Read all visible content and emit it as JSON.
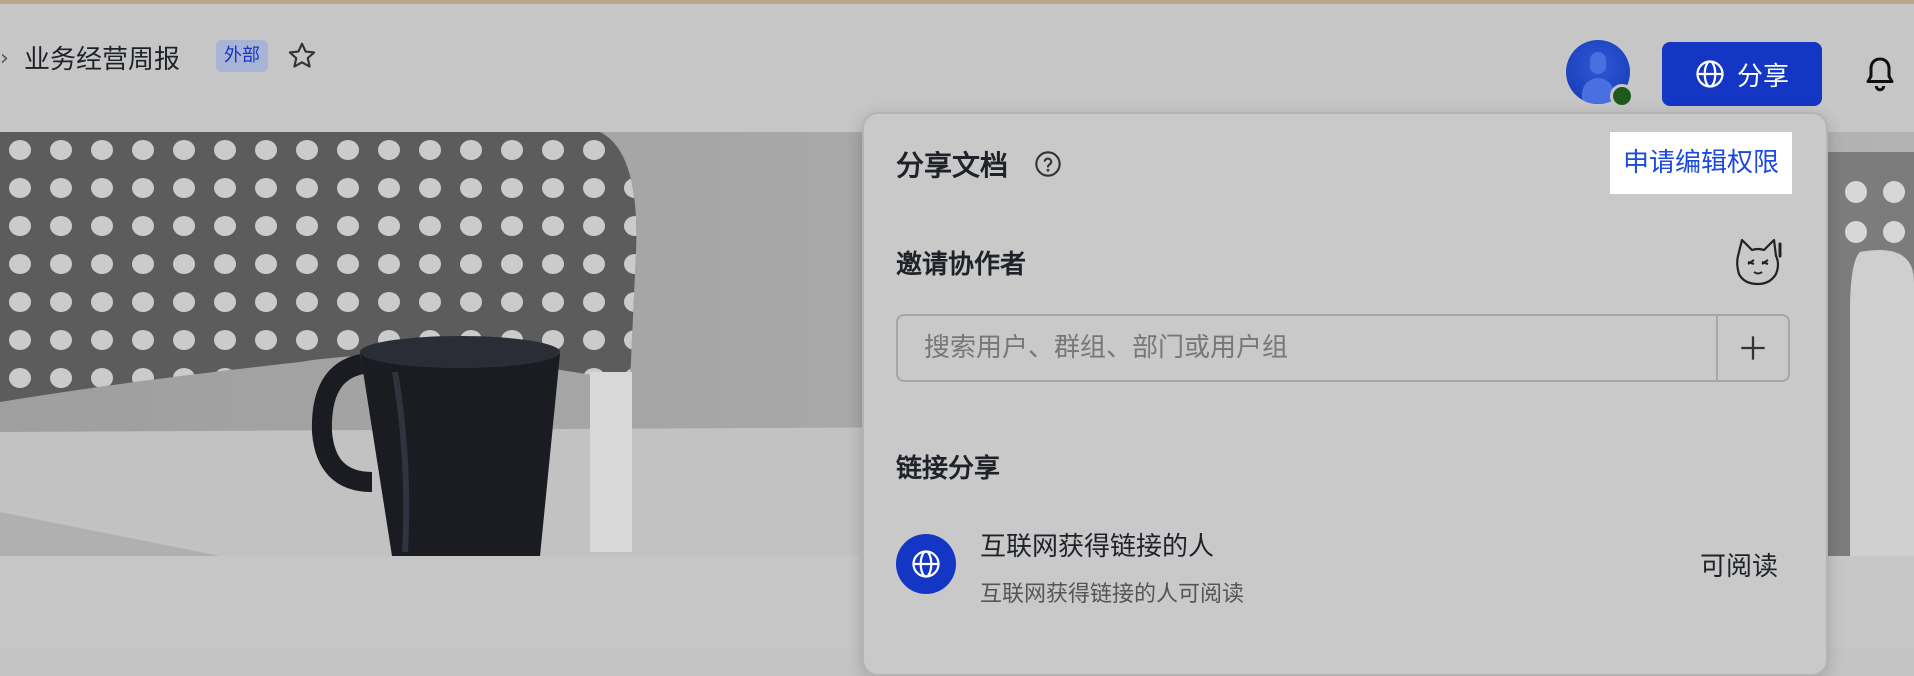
{
  "header": {
    "breadcrumb_chevron": "›",
    "title": "业务经营周报",
    "tag": "外部",
    "share_label": "分享",
    "presence_color": "#1e5a1e"
  },
  "icons": {
    "star": "star-icon",
    "avatar": "user-avatar",
    "globe": "globe-icon",
    "bell": "bell-icon",
    "help": "help-icon",
    "mascot": "cat-mascot-icon",
    "add": "plus-icon"
  },
  "popover": {
    "title": "分享文档",
    "request_edit": "申请编辑权限",
    "invite_heading": "邀请协作者",
    "search_placeholder": "搜索用户、群组、部门或用户组",
    "link_share_heading": "链接分享",
    "link_share_title": "互联网获得链接的人",
    "link_share_desc": "互联网获得链接的人可阅读",
    "link_permission": "可阅读"
  },
  "colors": {
    "accent": "#1336c4",
    "link": "#1c49e0",
    "tag_bg": "#a8b4d6"
  }
}
